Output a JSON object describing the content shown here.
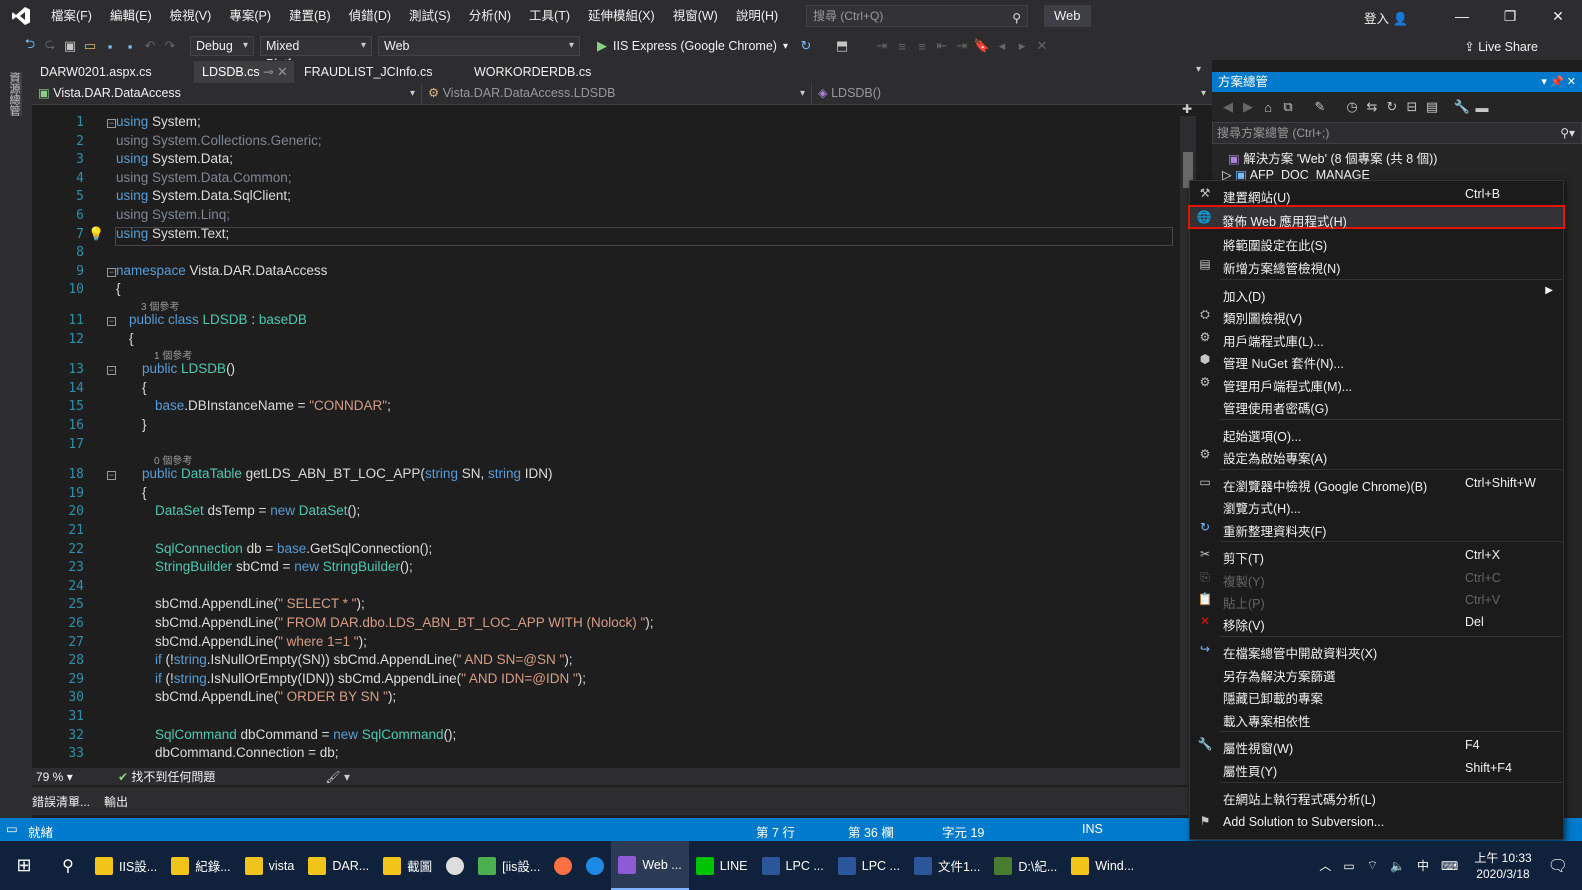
{
  "menu": {
    "items": [
      "檔案(F)",
      "編輯(E)",
      "檢視(V)",
      "專案(P)",
      "建置(B)",
      "偵錯(D)",
      "測試(S)",
      "分析(N)",
      "工具(T)",
      "延伸模組(X)",
      "視窗(W)",
      "說明(H)"
    ],
    "search_placeholder": "搜尋 (Ctrl+Q)",
    "solution_name": "Web",
    "sign_in": "登入"
  },
  "toolbar": {
    "config": "Debug",
    "platform": "Mixed Platforms",
    "project": "Web",
    "run_target": "IIS Express (Google Chrome)",
    "live_share": "Live Share"
  },
  "left_strip": {
    "label": "資源總管"
  },
  "doc_tabs": [
    {
      "label": "DARW0201.aspx.cs",
      "active": false
    },
    {
      "label": "LDSDB.cs",
      "active": true
    },
    {
      "label": "FRAUDLIST_JCInfo.cs",
      "active": false
    },
    {
      "label": "WORKORDERDB.cs",
      "active": false
    }
  ],
  "navbar": {
    "project": "Vista.DAR.DataAccess",
    "type": "Vista.DAR.DataAccess.LDSDB",
    "member": "LDSDB()"
  },
  "code": {
    "refs_3": "3 個參考",
    "refs_1": "1 個參考",
    "refs_0": "0 個參考",
    "lines": [
      "using System;",
      "using System.Collections.Generic;",
      "using System.Data;",
      "using System.Data.Common;",
      "using System.Data.SqlClient;",
      "using System.Linq;",
      "using System.Text;",
      "",
      "namespace Vista.DAR.DataAccess",
      "{",
      "public class LDSDB : baseDB",
      "{",
      "public LDSDB()",
      "{",
      "base.DBInstanceName = \"CONNDAR\";",
      "}",
      "",
      "public DataTable getLDS_ABN_BT_LOC_APP(string SN, string IDN)",
      "{",
      "DataSet dsTemp = new DataSet();",
      "",
      "SqlConnection db = base.GetSqlConnection();",
      "StringBuilder sbCmd = new StringBuilder();",
      "",
      "sbCmd.AppendLine(\" SELECT * \");",
      "sbCmd.AppendLine(\" FROM DAR.dbo.LDS_ABN_BT_LOC_APP WITH (Nolock) \");",
      "sbCmd.AppendLine(\" where 1=1 \");",
      "if (!string.IsNullOrEmpty(SN)) sbCmd.AppendLine(\" AND SN=@SN \");",
      "if (!string.IsNullOrEmpty(IDN)) sbCmd.AppendLine(\" AND IDN=@IDN \");",
      "sbCmd.AppendLine(\" ORDER BY SN \");",
      "",
      "SqlCommand dbCommand = new SqlCommand();",
      "dbCommand.Connection = db;"
    ]
  },
  "editor_status": {
    "zoom": "79 %",
    "issues": "找不到任何問題"
  },
  "bottom_tabs": [
    "錯誤清單...",
    "輸出"
  ],
  "status_bar": {
    "ready": "就緒",
    "line": "第 7 行",
    "col": "第 36 欄",
    "char": "字元 19",
    "mode": "INS"
  },
  "solution_explorer": {
    "title": "方案總管",
    "search_placeholder": "搜尋方案總管 (Ctrl+;)",
    "solution_node": "解決方案 'Web' (8 個專案 (共 8 個))",
    "project_node": "AFP_DOC_MANAGE"
  },
  "context_menu": {
    "items": [
      {
        "icon": "build-icon",
        "label": "建置網站(U)",
        "shortcut": "Ctrl+B"
      },
      {
        "icon": "publish-web-icon",
        "label": "發佈 Web 應用程式(H)",
        "shortcut": "",
        "highlighted": true
      },
      {
        "icon": "",
        "label": "將範圍設定在此(S)",
        "shortcut": ""
      },
      {
        "icon": "new-view-icon",
        "label": "新增方案總管檢視(N)",
        "shortcut": ""
      },
      {
        "icon": "",
        "label": "加入(D)",
        "shortcut": "",
        "submenu": true
      },
      {
        "icon": "class-view-icon",
        "label": "類別圖檢視(V)",
        "shortcut": ""
      },
      {
        "icon": "client-lib-icon",
        "label": "用戶端程式庫(L)...",
        "shortcut": ""
      },
      {
        "icon": "nuget-icon",
        "label": "管理 NuGet 套件(N)...",
        "shortcut": ""
      },
      {
        "icon": "client-lib-icon",
        "label": "管理用戶端程式庫(M)...",
        "shortcut": ""
      },
      {
        "icon": "",
        "label": "管理使用者密碼(G)",
        "shortcut": ""
      },
      {
        "icon": "",
        "label": "起始選項(O)...",
        "shortcut": ""
      },
      {
        "icon": "gear-icon",
        "label": "設定為啟始專案(A)",
        "shortcut": ""
      },
      {
        "icon": "browser-icon",
        "label": "在瀏覽器中檢視 (Google Chrome)(B)",
        "shortcut": "Ctrl+Shift+W"
      },
      {
        "icon": "",
        "label": "瀏覽方式(H)...",
        "shortcut": ""
      },
      {
        "icon": "refresh-icon",
        "label": "重新整理資料夾(F)",
        "shortcut": ""
      },
      {
        "icon": "cut-icon",
        "label": "剪下(T)",
        "shortcut": "Ctrl+X"
      },
      {
        "icon": "copy-icon",
        "label": "複製(Y)",
        "shortcut": "Ctrl+C",
        "disabled": true
      },
      {
        "icon": "paste-icon",
        "label": "貼上(P)",
        "shortcut": "Ctrl+V",
        "disabled": true
      },
      {
        "icon": "delete-icon",
        "label": "移除(V)",
        "shortcut": "Del"
      },
      {
        "icon": "open-folder-icon",
        "label": "在檔案總管中開啟資料夾(X)",
        "shortcut": ""
      },
      {
        "icon": "",
        "label": "另存為解決方案篩選",
        "shortcut": ""
      },
      {
        "icon": "",
        "label": "隱藏已卸載的專案",
        "shortcut": ""
      },
      {
        "icon": "",
        "label": "載入專案相依性",
        "shortcut": ""
      },
      {
        "icon": "wrench-icon",
        "label": "屬性視窗(W)",
        "shortcut": "F4"
      },
      {
        "icon": "",
        "label": "屬性頁(Y)",
        "shortcut": "Shift+F4"
      },
      {
        "icon": "",
        "label": "在網站上執行程式碼分析(L)",
        "shortcut": ""
      },
      {
        "icon": "subversion-icon",
        "label": "Add Solution to Subversion...",
        "shortcut": ""
      }
    ]
  },
  "taskbar": {
    "items": [
      {
        "label": "IIS設...",
        "color": "#f0c419"
      },
      {
        "label": "紀錄...",
        "color": "#f0c419"
      },
      {
        "label": "vista",
        "color": "#f0c419"
      },
      {
        "label": "DAR...",
        "color": "#f0c419"
      },
      {
        "label": "截圖",
        "color": "#f0c419"
      },
      {
        "label": "",
        "color": "#dddddd"
      },
      {
        "label": "[iis設...",
        "color": "#4caf50"
      },
      {
        "label": "",
        "color": "#ff7043"
      },
      {
        "label": "",
        "color": "#1e88e5"
      },
      {
        "label": "Web ...",
        "color": "#8e5bd6",
        "active": true
      },
      {
        "label": "LINE",
        "color": "#00c300"
      },
      {
        "label": "LPC ...",
        "color": "#2b579a"
      },
      {
        "label": "LPC ...",
        "color": "#2b579a"
      },
      {
        "label": "文件1...",
        "color": "#2b579a"
      },
      {
        "label": "D:\\紀...",
        "color": "#4a7c2f"
      },
      {
        "label": "Wind...",
        "color": "#f0c419"
      }
    ],
    "ime": "中",
    "time": "上午 10:33",
    "date": "2020/3/18"
  },
  "colors": {
    "accent": "#007acc",
    "highlight_border": "#e51400"
  }
}
